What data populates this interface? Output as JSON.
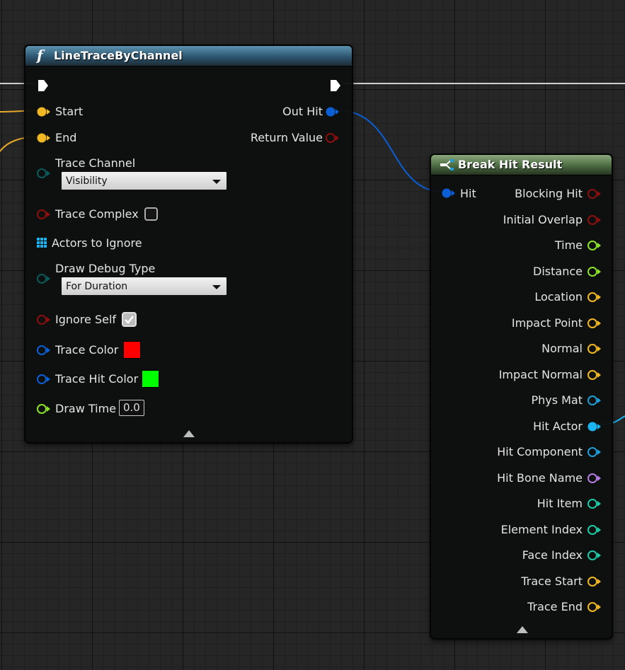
{
  "line_trace_node": {
    "title": "LineTraceByChannel",
    "function_icon": "function-icon",
    "pins": {
      "start": "Start",
      "end": "End",
      "trace_channel": "Trace Channel",
      "trace_complex": "Trace Complex",
      "actors_to_ignore": "Actors to Ignore",
      "draw_debug_type": "Draw Debug Type",
      "ignore_self": "Ignore Self",
      "trace_color": "Trace Color",
      "trace_hit_color": "Trace Hit Color",
      "draw_time": "Draw Time",
      "out_hit": "Out Hit",
      "return_value": "Return Value"
    },
    "trace_channel_value": "Visibility",
    "draw_debug_type_value": "For Duration",
    "trace_complex_checked": false,
    "ignore_self_checked": true,
    "trace_color": "#ff0000",
    "trace_hit_color": "#00ff00",
    "draw_time_value": "0.0",
    "header_color": "#3c6f8a"
  },
  "break_hit_node": {
    "title": "Break Hit Result",
    "struct_icon": "break-struct-icon",
    "input_pin": "Hit",
    "outputs": [
      {
        "label": "Blocking Hit",
        "color": "#8c0f0f"
      },
      {
        "label": "Initial Overlap",
        "color": "#8c0f0f"
      },
      {
        "label": "Time",
        "color": "#8ce22a"
      },
      {
        "label": "Distance",
        "color": "#8ce22a"
      },
      {
        "label": "Location",
        "color": "#f2b823"
      },
      {
        "label": "Impact Point",
        "color": "#f2b823"
      },
      {
        "label": "Normal",
        "color": "#f2b823"
      },
      {
        "label": "Impact Normal",
        "color": "#f2b823"
      },
      {
        "label": "Phys Mat",
        "color": "#1e9ed6"
      },
      {
        "label": "Hit Actor",
        "color": "#1ab4f4"
      },
      {
        "label": "Hit Component",
        "color": "#1e9ed6"
      },
      {
        "label": "Hit Bone Name",
        "color": "#b47ce0"
      },
      {
        "label": "Hit Item",
        "color": "#1ec9a6"
      },
      {
        "label": "Element Index",
        "color": "#1ec9a6"
      },
      {
        "label": "Face Index",
        "color": "#1ec9a6"
      },
      {
        "label": "Trace Start",
        "color": "#f2b823"
      },
      {
        "label": "Trace End",
        "color": "#f2b823"
      }
    ],
    "header_color": "#4c6a42"
  },
  "pin_colors": {
    "vector": "#f2b823",
    "struct": "#0a5fd6",
    "bool": "#8c0f0f",
    "channel": "#0b5a5a",
    "object_array": "#1ab4f4",
    "linear_color": "#0a5fd6",
    "float": "#8ce22a",
    "exec": "#ffffff"
  }
}
